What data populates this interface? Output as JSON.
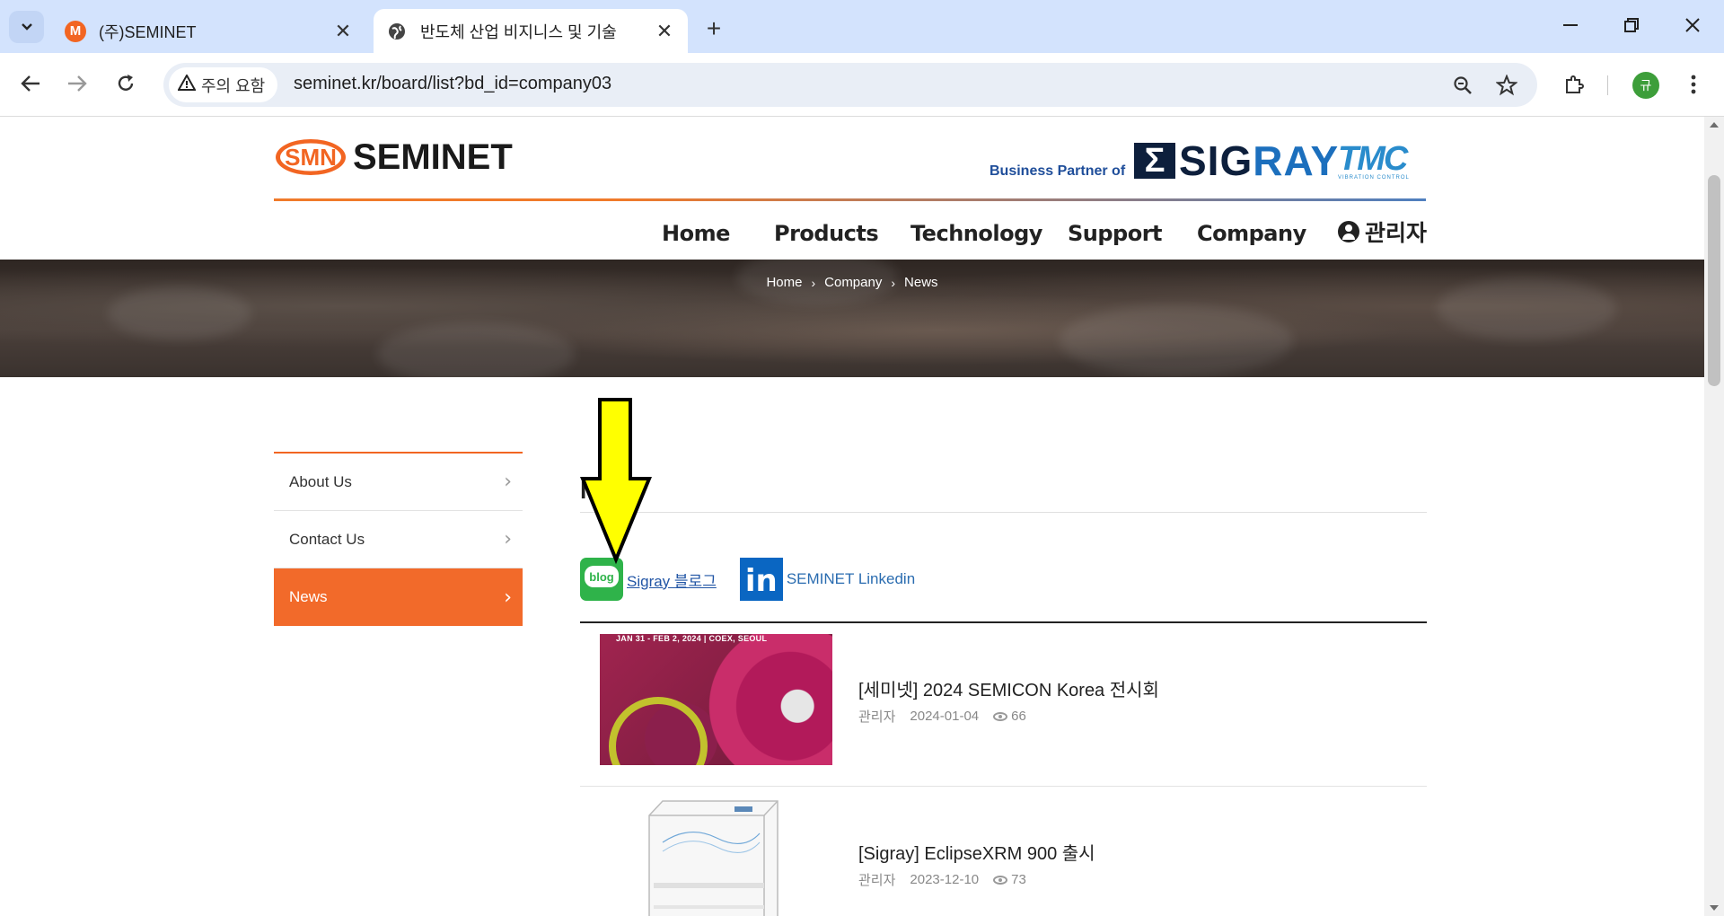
{
  "browser": {
    "tabs": [
      {
        "title": "(주)SEMINET",
        "favicon_letter": "M",
        "favicon_color": "#f26522",
        "active": false
      },
      {
        "title": "반도체 산업 비지니스 및 기술",
        "active": true
      }
    ],
    "security_label": "주의 요함",
    "url": "seminet.kr/board/list?bd_id=company03",
    "profile_initial": "규"
  },
  "site": {
    "logo_badge": "SMN",
    "logo_text": "SEMINET",
    "partner_label": "Business Partner of",
    "sigray_mark": "Σ",
    "sigray_text_a": "SIG",
    "sigray_text_b": "RAY",
    "tmc_text": "TMC",
    "tmc_sub": "VIBRATION CONTROL",
    "nav": [
      "Home",
      "Products",
      "Technology",
      "Support",
      "Company"
    ],
    "admin_label": "관리자",
    "breadcrumb": [
      "Home",
      "Company",
      "News"
    ]
  },
  "sidebar": {
    "items": [
      {
        "label": "About Us",
        "active": false
      },
      {
        "label": "Contact Us",
        "active": false
      },
      {
        "label": "News",
        "active": true
      }
    ]
  },
  "main": {
    "title": "N",
    "blog_icon_text": "blog",
    "blog_link": "Sigray 블로그",
    "linkedin_icon_text": "in",
    "linkedin_link": "SEMINET Linkedin",
    "news": [
      {
        "title": "[세미넷] 2024 SEMICON Korea 전시회",
        "author": "관리자",
        "date": "2024-01-04",
        "views": "66",
        "thumb_caption": "JAN 31 - FEB 2, 2024 | COEX, SEOUL"
      },
      {
        "title": "[Sigray] EclipseXRM 900 출시",
        "author": "관리자",
        "date": "2023-12-10",
        "views": "73"
      }
    ]
  },
  "colors": {
    "brand_orange": "#f26522",
    "brand_blue": "#1f4e9a",
    "arrow_yellow": "#ffff00"
  }
}
